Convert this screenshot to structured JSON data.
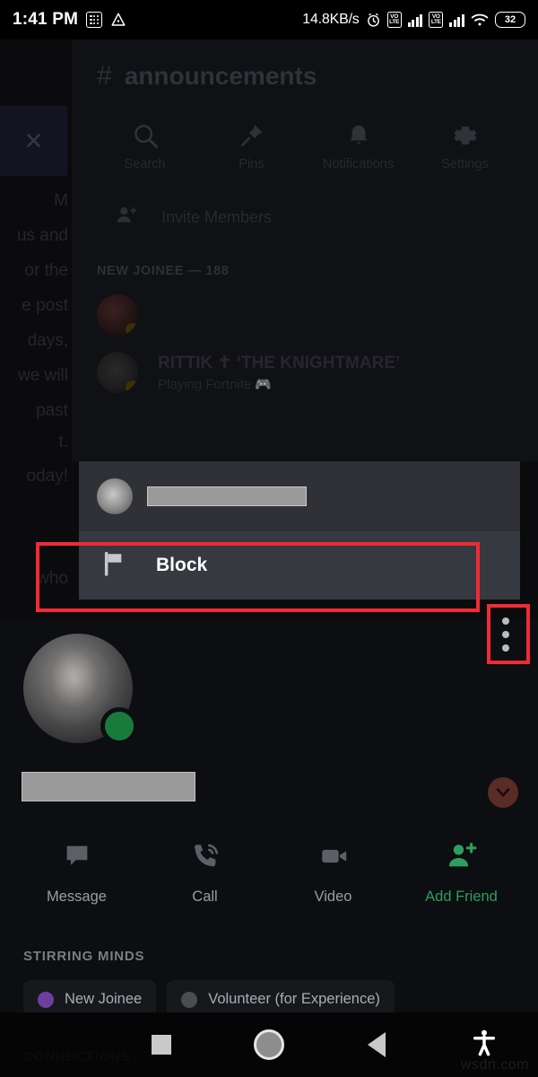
{
  "status_bar": {
    "time": "1:41 PM",
    "grid_icon": "grid-icon",
    "drive_icon": "triangle-icon",
    "network_speed": "14.8KB/s",
    "alarm_icon": "alarm-icon",
    "volte_label_1": "VO LTE",
    "volte_label_2": "VO LTE",
    "wifi_icon": "wifi-icon",
    "battery_level": "32"
  },
  "channel": {
    "hash": "#",
    "name": "announcements",
    "actions": [
      {
        "label": "Search",
        "icon": "search-icon"
      },
      {
        "label": "Pins",
        "icon": "pin-icon"
      },
      {
        "label": "Notifications",
        "icon": "bell-icon"
      },
      {
        "label": "Settings",
        "icon": "gear-icon"
      }
    ],
    "invite_label": "Invite Members",
    "invite_icon": "add-person-icon",
    "members_header": "NEW JOINEE — 188",
    "members": [
      {
        "name": "",
        "subtitle": ""
      },
      {
        "name": "RITTIK ✝ ‘THE KNIGHTMARE’",
        "subtitle": "Playing Fortnite 🎮"
      }
    ]
  },
  "background_chat": {
    "close_icon": "close-icon",
    "lines": [
      "M",
      "us and",
      "or the",
      "e post",
      "days,",
      "we will",
      "past"
    ],
    "lines2": [
      "t.",
      "oday!"
    ],
    "lines3": [
      "who"
    ]
  },
  "context_menu": {
    "avatar_icon": "user-avatar",
    "username_redacted": "",
    "items": [
      {
        "label": "Block",
        "icon": "flag-icon"
      }
    ]
  },
  "overflow": {
    "icon": "more-vertical-icon"
  },
  "profile": {
    "avatar_icon": "user-avatar-large",
    "status": "online",
    "status_color": "#1a7a3c",
    "username_redacted": "",
    "expand_icon": "chevron-down-icon",
    "actions": [
      {
        "label": "Message",
        "icon": "message-icon",
        "accent": false
      },
      {
        "label": "Call",
        "icon": "call-icon",
        "accent": false
      },
      {
        "label": "Video",
        "icon": "video-icon",
        "accent": false
      },
      {
        "label": "Add Friend",
        "icon": "add-friend-icon",
        "accent": true
      }
    ],
    "roles_header": "STIRRING MINDS",
    "roles": [
      {
        "label": "New Joinee",
        "color": "#6b3fa0"
      },
      {
        "label": "Volunteer (for Experience)",
        "color": "#4a4d52"
      }
    ],
    "connections_header": "CONNECTIONS"
  },
  "nav_bar": {
    "recents_icon": "square-icon",
    "home_icon": "circle-icon",
    "back_icon": "triangle-back-icon",
    "accessibility_icon": "accessibility-icon"
  },
  "watermark": "wsdn.com",
  "annotations": {
    "color": "#ef2b36",
    "block_target": "Block",
    "overflow_target": "more-vertical-icon"
  }
}
